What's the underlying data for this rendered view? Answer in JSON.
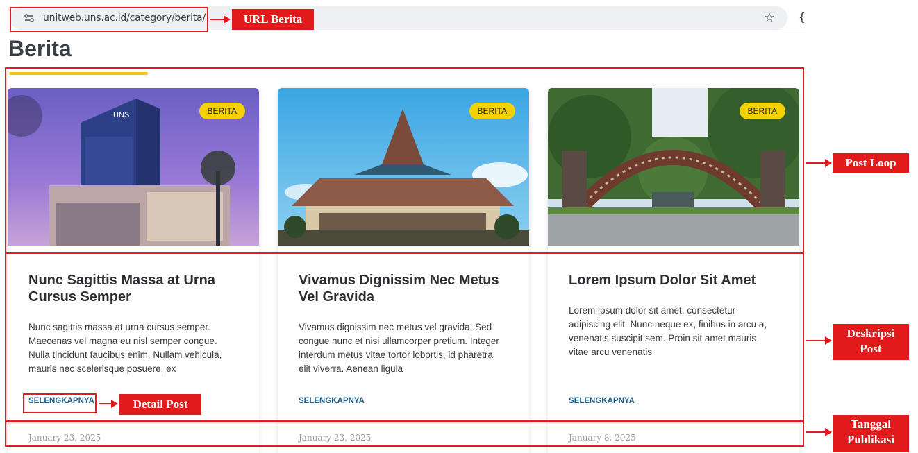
{
  "browser": {
    "url": "unitweb.uns.ac.id/category/berita/"
  },
  "page": {
    "title": "Berita"
  },
  "posts": [
    {
      "badge": "BERITA",
      "title": "Nunc Sagittis Massa at Urna Cursus Semper",
      "excerpt": "Nunc sagittis massa at urna cursus semper. Maecenas vel magna eu nisl semper congue. Nulla tincidunt faucibus enim. Nullam vehicula, mauris nec scelerisque posuere, ex",
      "read_more": "SELENGKAPNYA",
      "date": "January 23, 2025"
    },
    {
      "badge": "BERITA",
      "title": "Vivamus Dignissim Nec Metus Vel Gravida",
      "excerpt": "Vivamus dignissim nec metus vel gravida. Sed congue nunc et nisi ullamcorper pretium. Integer interdum metus vitae tortor lobortis, id pharetra elit viverra. Aenean ligula",
      "read_more": "SELENGKAPNYA",
      "date": "January 23, 2025"
    },
    {
      "badge": "BERITA",
      "title": "Lorem Ipsum Dolor Sit Amet",
      "excerpt": "Lorem ipsum dolor sit amet, consectetur adipiscing elit. Nunc neque ex, finibus in arcu a, venenatis suscipit sem. Proin sit amet mauris vitae arcu venenatis",
      "read_more": "SELENGKAPNYA",
      "date": "January 8, 2025"
    }
  ],
  "annotations": {
    "url_berita": "URL Berita",
    "post_loop": "Post Loop",
    "deskripsi_post_1": "Deskripsi",
    "deskripsi_post_2": "Post",
    "detail_post": "Detail Post",
    "tanggal_publikasi_1": "Tanggal",
    "tanggal_publikasi_2": "Publikasi"
  },
  "colors": {
    "annotation_red": "#e11b1b",
    "badge_yellow": "#f5d100",
    "link_blue": "#1a5d86",
    "title_underline": "#f2c31a"
  }
}
